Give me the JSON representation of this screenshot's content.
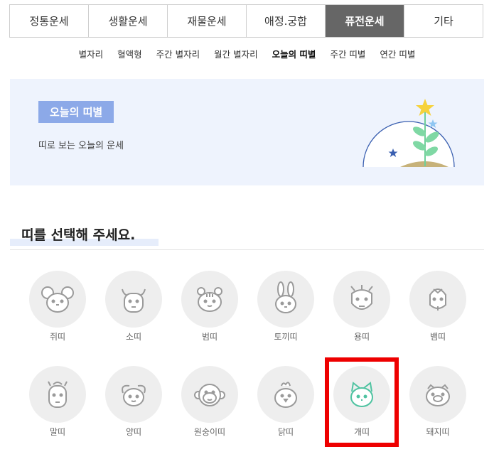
{
  "main_tabs": [
    {
      "label": "정통운세"
    },
    {
      "label": "생활운세"
    },
    {
      "label": "재물운세"
    },
    {
      "label": "애정.궁합"
    },
    {
      "label": "퓨전운세"
    },
    {
      "label": "기타"
    }
  ],
  "active_main_tab": "퓨전운세",
  "sub_tabs": [
    {
      "label": "별자리"
    },
    {
      "label": "혈액형"
    },
    {
      "label": "주간 별자리"
    },
    {
      "label": "월간 별자리"
    },
    {
      "label": "오늘의 띠별"
    },
    {
      "label": "주간 띠별"
    },
    {
      "label": "연간 띠별"
    }
  ],
  "active_sub_tab": "오늘의 띠별",
  "banner": {
    "title": "오늘의 띠별",
    "description": "띠로 보는 오늘의 운세"
  },
  "section": {
    "title": "띠를 선택해 주세요."
  },
  "zodiac": [
    {
      "label": "쥐띠",
      "icon": "rat-icon"
    },
    {
      "label": "소띠",
      "icon": "ox-icon"
    },
    {
      "label": "범띠",
      "icon": "tiger-icon"
    },
    {
      "label": "토끼띠",
      "icon": "rabbit-icon"
    },
    {
      "label": "용띠",
      "icon": "dragon-icon"
    },
    {
      "label": "뱀띠",
      "icon": "snake-icon"
    },
    {
      "label": "말띠",
      "icon": "horse-icon"
    },
    {
      "label": "양띠",
      "icon": "sheep-icon"
    },
    {
      "label": "원숭이띠",
      "icon": "monkey-icon"
    },
    {
      "label": "닭띠",
      "icon": "rooster-icon"
    },
    {
      "label": "개띠",
      "icon": "dog-icon"
    },
    {
      "label": "돼지띠",
      "icon": "pig-icon"
    }
  ],
  "selected_zodiac": "개띠",
  "colors": {
    "active_tab_bg": "#666666",
    "banner_bg": "#eef3fd",
    "badge_bg": "#8ca9e8",
    "icon_gray": "#9a9a9a",
    "icon_selected": "#4fc3a1",
    "highlight_red": "#ee0000"
  }
}
